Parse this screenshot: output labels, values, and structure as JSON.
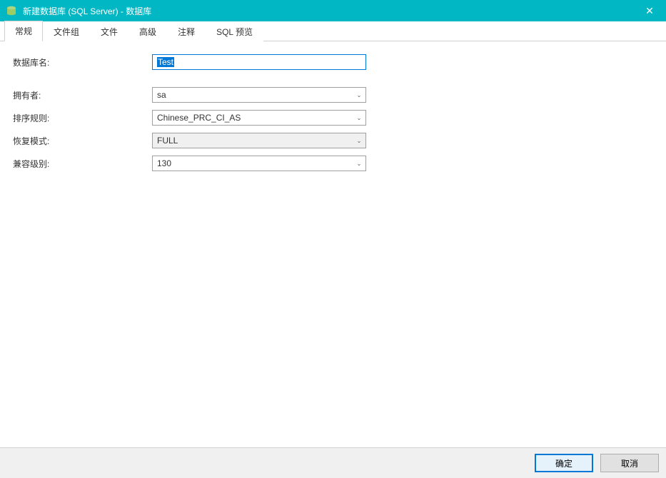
{
  "titlebar": {
    "title": "新建数据库 (SQL Server) - 数据库",
    "close": "✕"
  },
  "tabs": [
    {
      "label": "常规",
      "active": true
    },
    {
      "label": "文件组",
      "active": false
    },
    {
      "label": "文件",
      "active": false
    },
    {
      "label": "高级",
      "active": false
    },
    {
      "label": "注释",
      "active": false
    },
    {
      "label": "SQL 预览",
      "active": false
    }
  ],
  "form": {
    "database_name": {
      "label": "数据库名:",
      "value": "Test"
    },
    "owner": {
      "label": "拥有者:",
      "value": "sa"
    },
    "collation": {
      "label": "排序规则:",
      "value": "Chinese_PRC_CI_AS"
    },
    "recovery_model": {
      "label": "恢复模式:",
      "value": "FULL",
      "disabled": true
    },
    "compatibility": {
      "label": "兼容级别:",
      "value": "130"
    }
  },
  "footer": {
    "ok": "确定",
    "cancel": "取消"
  }
}
